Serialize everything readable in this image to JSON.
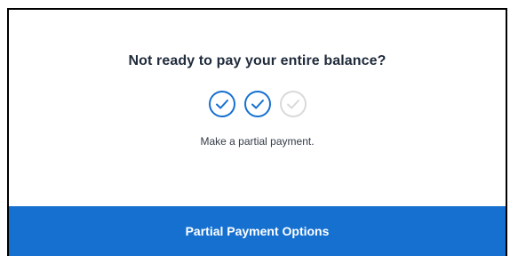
{
  "promo": {
    "heading": "Not ready to pay your entire balance?",
    "subtext": "Make a partial payment.",
    "steps": [
      {
        "icon": "check-circle-icon",
        "state": "complete"
      },
      {
        "icon": "check-circle-icon",
        "state": "complete"
      },
      {
        "icon": "check-circle-icon",
        "state": "incomplete"
      }
    ],
    "button_label": "Partial Payment Options"
  },
  "colors": {
    "accent": "#1570d0",
    "heading_text": "#1f2a3a",
    "step_complete": "#1570d0",
    "step_incomplete": "#d9d9d9"
  }
}
